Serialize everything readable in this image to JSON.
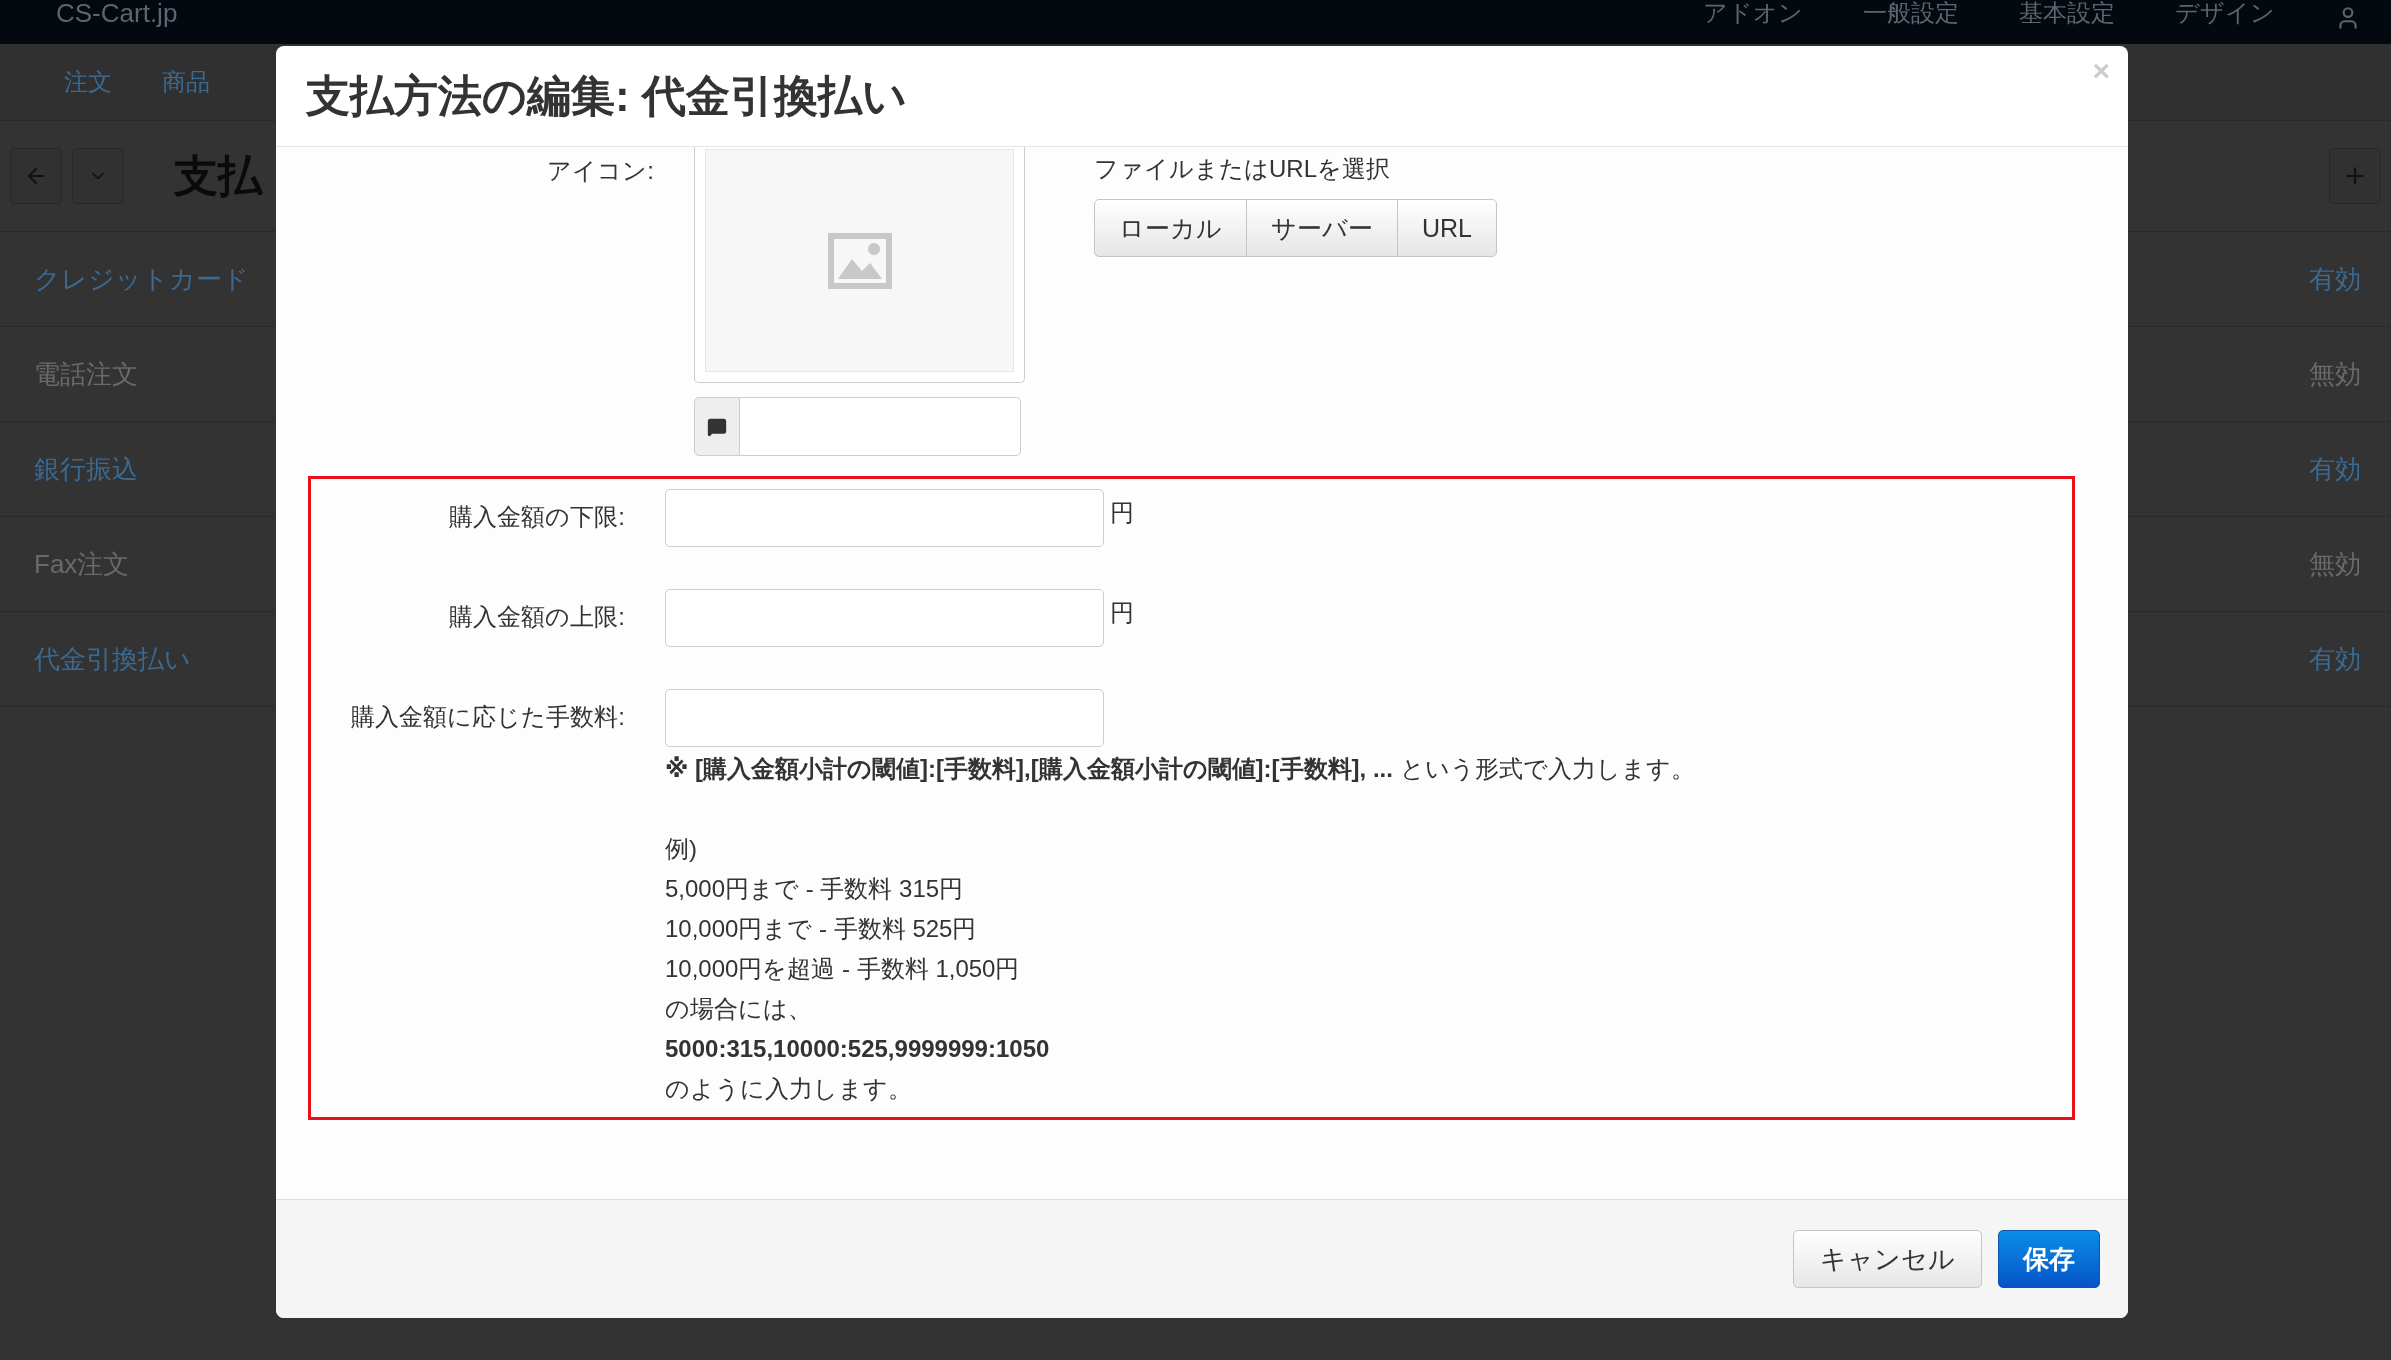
{
  "top_nav": {
    "brand": "CS-Cart.jp",
    "menus": [
      "アドオン",
      "一般設定",
      "基本設定",
      "デザイン"
    ]
  },
  "sub_nav": {
    "menus": [
      "注文",
      "商品"
    ]
  },
  "page": {
    "title": "支払"
  },
  "payment_methods": [
    {
      "name": "クレジットカード",
      "status": "有効",
      "enabled": true
    },
    {
      "name": "電話注文",
      "status": "無効",
      "enabled": false
    },
    {
      "name": "銀行振込",
      "status": "有効",
      "enabled": true
    },
    {
      "name": "Fax注文",
      "status": "無効",
      "enabled": false
    },
    {
      "name": "代金引換払い",
      "status": "有効",
      "enabled": true
    }
  ],
  "dialog": {
    "title": "支払方法の編集: 代金引換払い",
    "close": "×",
    "icon_label": "アイコン:",
    "file_source_label": "ファイルまたはURLを選択",
    "source_buttons": [
      "ローカル",
      "サーバー",
      "URL"
    ],
    "fields": [
      {
        "label": "購入金額の下限:",
        "unit": "円"
      },
      {
        "label": "購入金額の上限:",
        "unit": "円"
      },
      {
        "label": "購入金額に応じた手数料:"
      }
    ],
    "help": {
      "format": "**※ [購入金額小計の閾値]:[手数料],[購入金額小計の閾値]:[手数料], ...** という形式で入力します。",
      "example_lines": [
        "例)",
        "5,000円まで - 手数料 315円",
        "10,000円まで - 手数料 525円",
        "10,000円を超過 - 手数料 1,050円",
        "の場合には、"
      ],
      "example_value": "5000:315,10000:525,9999999:1050",
      "closing": "のように入力します。"
    },
    "buttons": {
      "cancel": "キャンセル",
      "save": "保存"
    }
  }
}
